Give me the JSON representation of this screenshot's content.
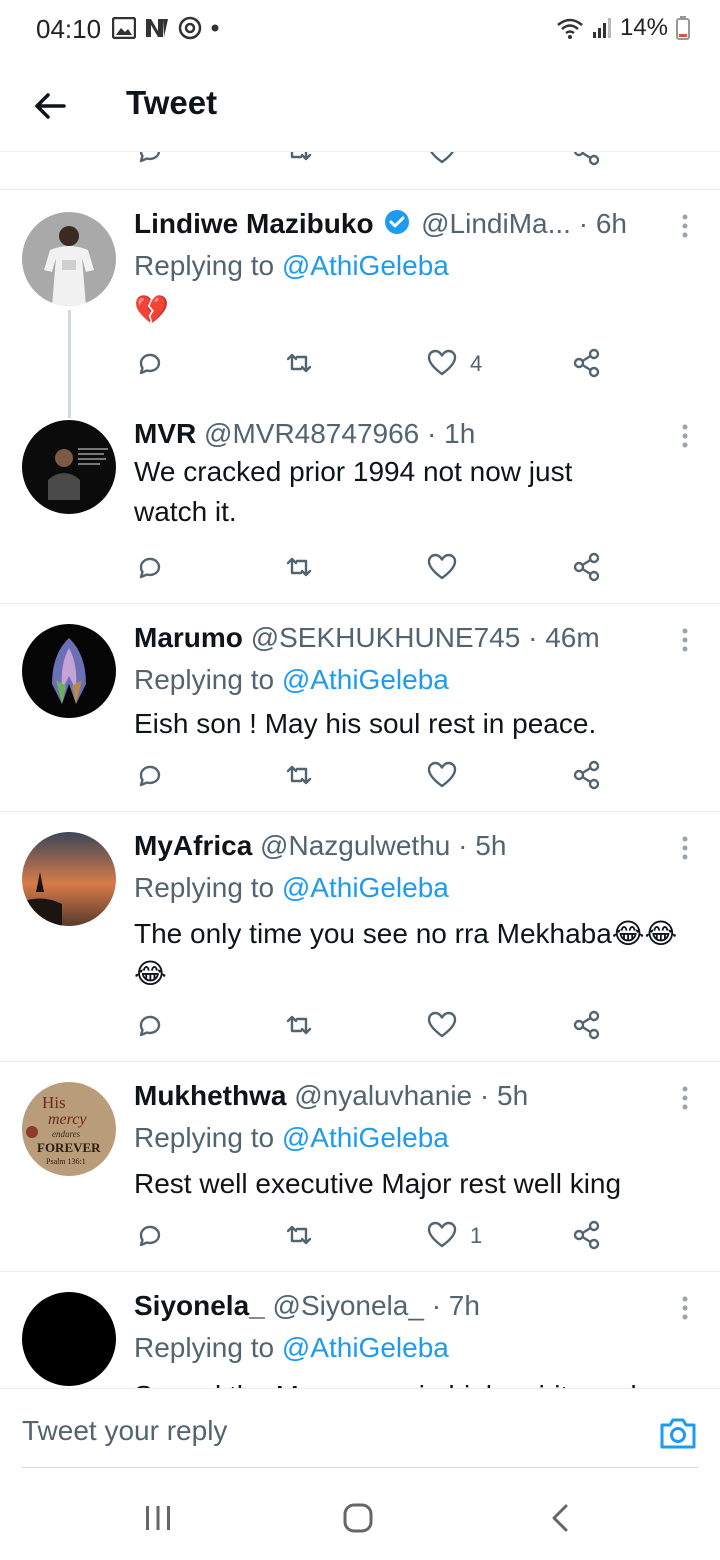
{
  "status_bar": {
    "time": "04:10",
    "battery": "14%"
  },
  "header": {
    "title": "Tweet"
  },
  "tweets": [
    {
      "name": "Lindiwe Mazibuko",
      "handle": "@LindiMa...",
      "time": "· 6h",
      "replying_label": "Replying to",
      "reply_to": "@AthiGeleba",
      "text": "💔",
      "likes": "4"
    },
    {
      "name": "MVR",
      "handle": "@MVR48747966",
      "time": "· 1h",
      "text": "We cracked prior 1994 not now just watch it."
    },
    {
      "name": "Marumo",
      "handle": "@SEKHUKHUNE745",
      "time": "· 46m",
      "replying_label": "Replying to",
      "reply_to": "@AthiGeleba",
      "text": "Eish son ! May his soul rest in peace."
    },
    {
      "name": "MyAfrica",
      "handle": "@Nazgulwethu",
      "time": "· 5h",
      "replying_label": "Replying to",
      "reply_to": "@AthiGeleba",
      "text": "The only time you see no rra Mekhaba😂😂😂"
    },
    {
      "name": "Mukhethwa",
      "handle": "@nyaluvhanie",
      "time": "· 5h",
      "replying_label": "Replying to",
      "reply_to": "@AthiGeleba",
      "text": "Rest well executive Major rest well king",
      "likes": "1",
      "avatar_text": [
        "His",
        "mercy",
        "endures",
        "FOREVER",
        "Psalm 136:1"
      ]
    },
    {
      "name": "Siyonela_",
      "handle": "@Siyonela_",
      "time": "· 7h",
      "replying_label": "Replying to",
      "reply_to": "@AthiGeleba",
      "text": "So sad the Mayor was in high spirits and"
    }
  ],
  "reply_bar": {
    "placeholder": "Tweet your reply"
  },
  "colors": {
    "accent": "#1d9bf0",
    "text": "#0f1419",
    "secondary": "#536471",
    "divider": "#e6ecf0"
  }
}
